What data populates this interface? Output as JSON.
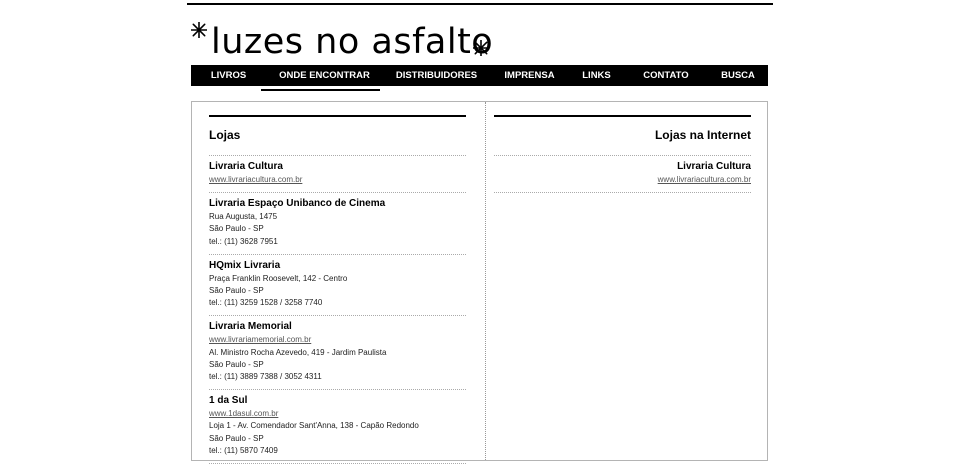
{
  "site": {
    "logo_text": "luzes no asfalto",
    "star_icon": "asterisk-star-icon"
  },
  "nav": {
    "items": [
      "LIVROS",
      "ONDE ENCONTRAR",
      "DISTRIBUIDORES",
      "IMPRENSA",
      "LINKS",
      "CONTATO",
      "BUSCA"
    ],
    "active": "ONDE ENCONTRAR"
  },
  "lojas": {
    "title": "Lojas",
    "stores": [
      {
        "name": "Livraria Cultura",
        "link": "www.livrariacultura.com.br",
        "lines": []
      },
      {
        "name": "Livraria Espaço Unibanco de Cinema",
        "link": "",
        "lines": [
          "Rua Augusta, 1475",
          "São Paulo - SP",
          "tel.: (11) 3628 7951"
        ]
      },
      {
        "name": "HQmix Livraria",
        "link": "",
        "lines": [
          "Praça Franklin Roosevelt, 142 - Centro",
          "São Paulo - SP",
          "tel.: (11) 3259 1528 / 3258 7740"
        ]
      },
      {
        "name": "Livraria Memorial",
        "link": "www.livrariamemorial.com.br",
        "lines": [
          "Al. Ministro Rocha Azevedo, 419 - Jardim Paulista",
          "São Paulo - SP",
          "tel.: (11) 3889 7388 / 3052 4311"
        ]
      },
      {
        "name": "1 da Sul",
        "link": "www.1dasul.com.br",
        "lines": [
          "Loja 1 - Av. Comendador Sant'Anna, 138 - Capão Redondo",
          "São Paulo - SP",
          "tel.: (11) 5870 7409"
        ]
      }
    ]
  },
  "internet": {
    "title": "Lojas na Internet",
    "stores": [
      {
        "name": "Livraria Cultura",
        "link": "www.livrariacultura.com.br",
        "lines": []
      }
    ]
  }
}
